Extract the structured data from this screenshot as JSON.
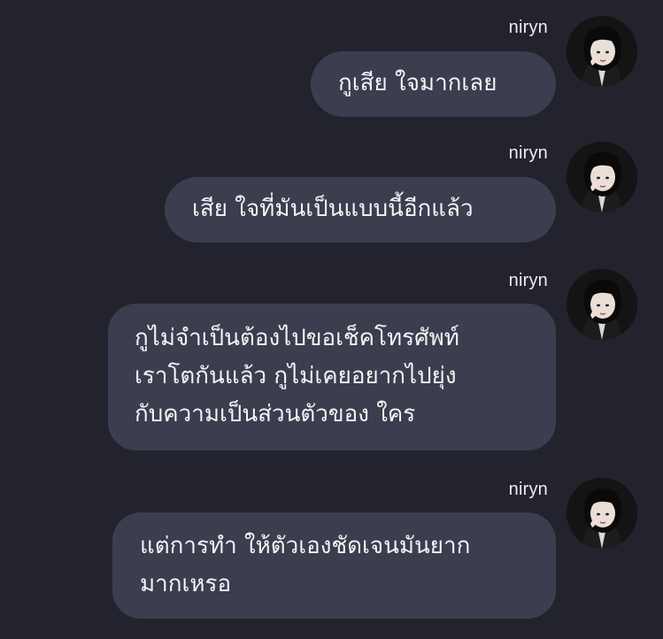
{
  "messages": [
    {
      "sender": "niryn",
      "lines": [
        "กูเสีย ใจมากเลย"
      ]
    },
    {
      "sender": "niryn",
      "lines": [
        "เสีย ใจที่มันเป็นแบบนี้อีกแล้ว"
      ]
    },
    {
      "sender": "niryn",
      "lines": [
        "กูไม่จำเป็นต้องไปขอเช็คโทรศัพท์",
        "เราโตกันแล้ว กูไม่เคยอยากไปยุ่ง",
        "กับความเป็นส่วนตัวของ ใคร"
      ]
    },
    {
      "sender": "niryn",
      "lines": [
        "แต่การทำ ให้ตัวเองชัดเจนมันยาก",
        "มากเหรอ"
      ]
    }
  ]
}
